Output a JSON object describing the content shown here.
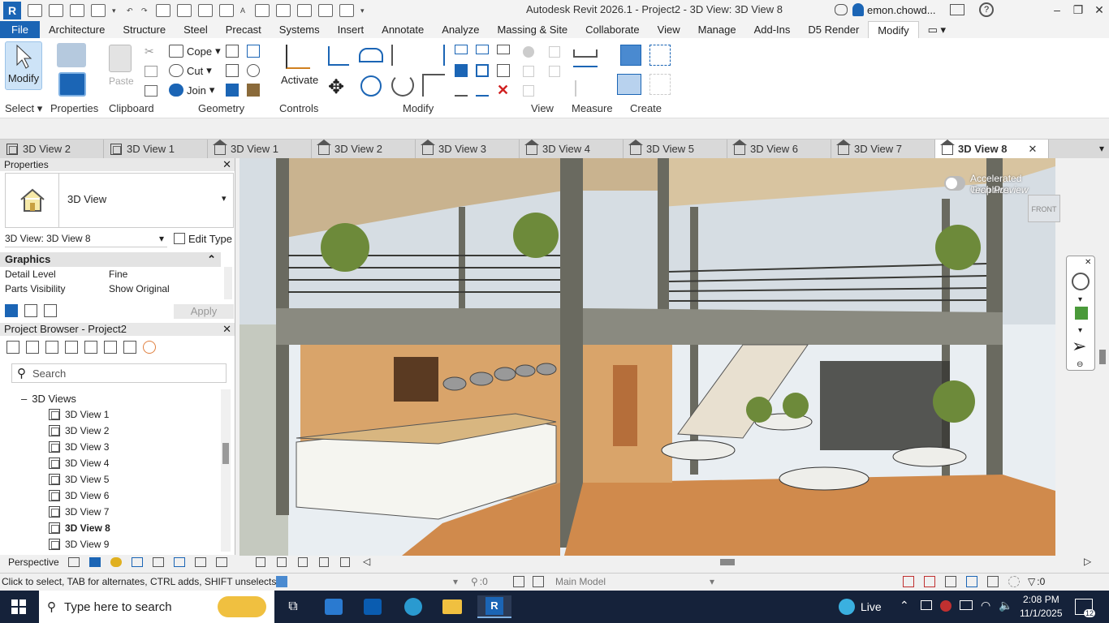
{
  "app": {
    "title": "Autodesk Revit 2026.1 - Project2 - 3D View: 3D View 8",
    "user": "emon.chowd...",
    "logo_letter": "R"
  },
  "ribbon_tabs": [
    "File",
    "Architecture",
    "Structure",
    "Steel",
    "Precast",
    "Systems",
    "Insert",
    "Annotate",
    "Analyze",
    "Massing & Site",
    "Collaborate",
    "View",
    "Manage",
    "Add-Ins",
    "D5 Render",
    "Modify"
  ],
  "ribbon": {
    "modify": "Modify",
    "properties": "Properties",
    "paste": "Paste",
    "cope": "Cope",
    "cut": "Cut",
    "join": "Join",
    "activate": "Activate",
    "panels": {
      "select": "Select",
      "properties": "Properties",
      "clipboard": "Clipboard",
      "geometry": "Geometry",
      "controls": "Controls",
      "modify": "Modify",
      "view": "View",
      "measure": "Measure",
      "create": "Create"
    }
  },
  "view_tabs": [
    "3D View 2",
    "3D View 1",
    "3D View 1",
    "3D View 2",
    "3D View 3",
    "3D View 4",
    "3D View 5",
    "3D View 6",
    "3D View 7",
    "3D View 8"
  ],
  "properties": {
    "title": "Properties",
    "type_name": "3D View",
    "instance_selector": "3D View: 3D View 8",
    "edit_type": "Edit Type",
    "section": "Graphics",
    "rows": [
      {
        "label": "Detail Level",
        "value": "Fine"
      },
      {
        "label": "Parts Visibility",
        "value": "Show Original"
      }
    ],
    "apply": "Apply"
  },
  "browser": {
    "title": "Project Browser - Project2",
    "search_placeholder": "Search",
    "folder": "3D Views",
    "items": [
      "3D View 1",
      "3D View 2",
      "3D View 3",
      "3D View 4",
      "3D View 5",
      "3D View 6",
      "3D View 7",
      "3D View 8",
      "3D View 9"
    ],
    "selected": "3D View 8"
  },
  "viewport": {
    "overlay_line1": "Accelerated Graphics",
    "overlay_line2": "Tech Preview",
    "viewcube_label": "FRONT"
  },
  "view_control": {
    "projection": "Perspective"
  },
  "status": {
    "hint": "Click to select, TAB for alternates, CTRL adds, SHIFT unselects.",
    "count1": ":0",
    "model": "Main Model",
    "filter_count": ":0"
  },
  "taskbar": {
    "search_placeholder": "Type here to search",
    "live": "Live",
    "time": "2:08 PM",
    "date": "11/1/2025",
    "notifications": "12"
  },
  "colors": {
    "file_tab": "#1b65b5",
    "taskbar": "#15223a",
    "accent_blue": "#1b65b5"
  }
}
